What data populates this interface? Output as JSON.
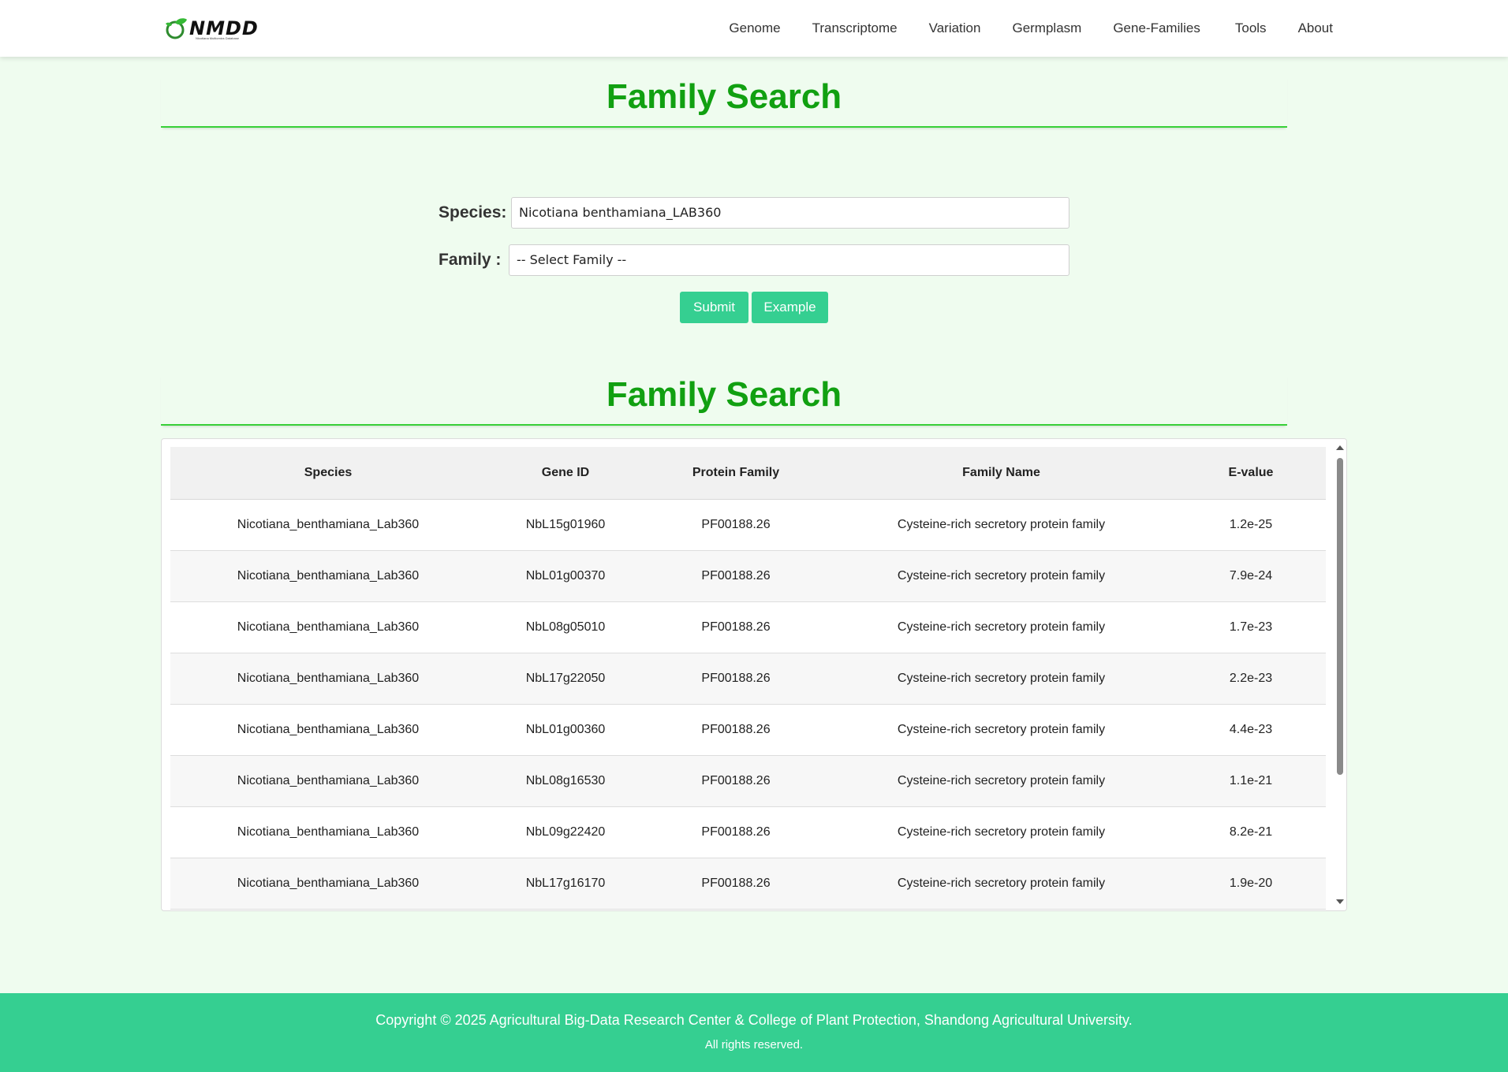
{
  "header": {
    "logo_text": "NMDD",
    "logo_subtext": "Nicotiana Multiomics Database",
    "nav": [
      "Genome",
      "Transcriptome",
      "Variation",
      "Germplasm",
      "Gene-Families",
      "Tools",
      "About"
    ]
  },
  "search_section": {
    "title": "Family Search",
    "species_label": "Species:",
    "species_value": "Nicotiana benthamiana_LAB360",
    "family_label": "Family :",
    "family_value": "-- Select Family --",
    "submit_label": "Submit",
    "example_label": "Example"
  },
  "results_section": {
    "title": "Family Search",
    "columns": [
      "Species",
      "Gene ID",
      "Protein Family",
      "Family Name",
      "E-value"
    ],
    "rows": [
      [
        "Nicotiana_benthamiana_Lab360",
        "NbL15g01960",
        "PF00188.26",
        "Cysteine-rich secretory protein family",
        "1.2e-25"
      ],
      [
        "Nicotiana_benthamiana_Lab360",
        "NbL01g00370",
        "PF00188.26",
        "Cysteine-rich secretory protein family",
        "7.9e-24"
      ],
      [
        "Nicotiana_benthamiana_Lab360",
        "NbL08g05010",
        "PF00188.26",
        "Cysteine-rich secretory protein family",
        "1.7e-23"
      ],
      [
        "Nicotiana_benthamiana_Lab360",
        "NbL17g22050",
        "PF00188.26",
        "Cysteine-rich secretory protein family",
        "2.2e-23"
      ],
      [
        "Nicotiana_benthamiana_Lab360",
        "NbL01g00360",
        "PF00188.26",
        "Cysteine-rich secretory protein family",
        "4.4e-23"
      ],
      [
        "Nicotiana_benthamiana_Lab360",
        "NbL08g16530",
        "PF00188.26",
        "Cysteine-rich secretory protein family",
        "1.1e-21"
      ],
      [
        "Nicotiana_benthamiana_Lab360",
        "NbL09g22420",
        "PF00188.26",
        "Cysteine-rich secretory protein family",
        "8.2e-21"
      ],
      [
        "Nicotiana_benthamiana_Lab360",
        "NbL17g16170",
        "PF00188.26",
        "Cysteine-rich secretory protein family",
        "1.9e-20"
      ]
    ]
  },
  "footer": {
    "copyright": "Copyright © 2025 Agricultural Big-Data Research Center & College of Plant Protection, Shandong Agricultural University.",
    "rights": "All rights reserved."
  },
  "colors": {
    "page_bg": "#effcef",
    "title_green": "#11a011",
    "accent": "#35cf91"
  },
  "icons": [
    "leaf-logo-icon",
    "scroll-up-arrow-icon",
    "scroll-down-arrow-icon"
  ]
}
